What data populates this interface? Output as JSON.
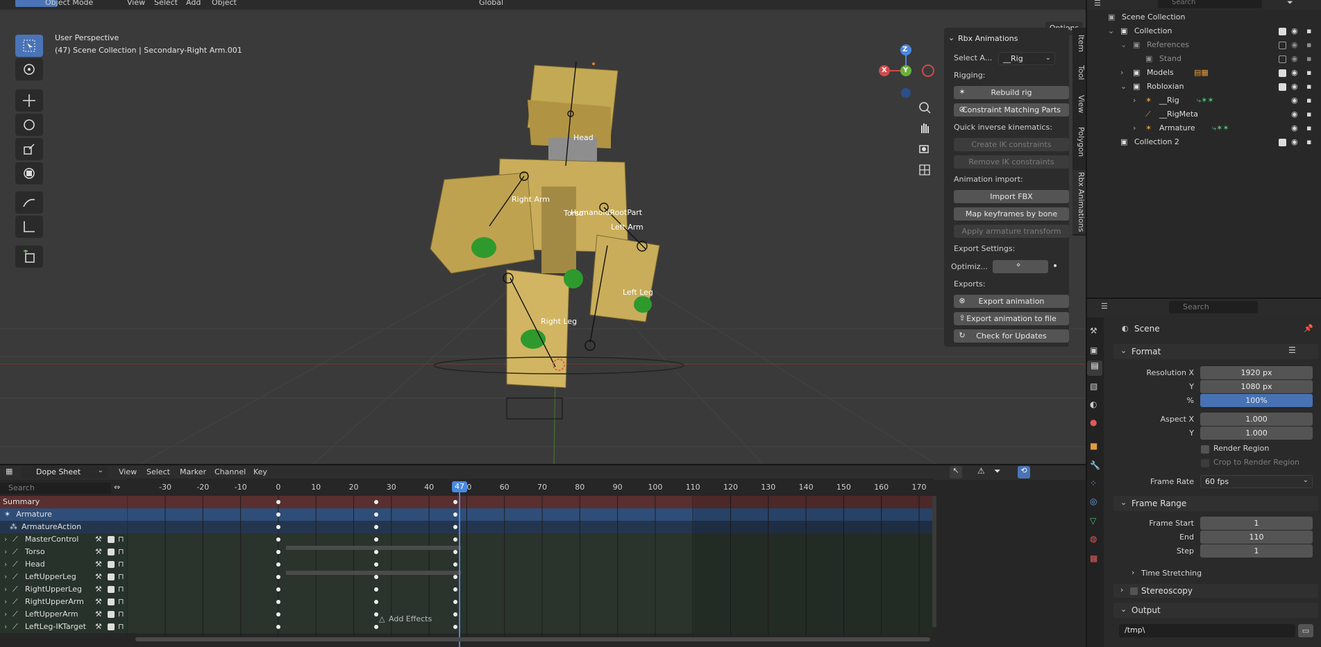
{
  "top_menu": {
    "mode": "Object Mode",
    "view": "View",
    "select": "Select",
    "add": "Add",
    "object": "Object",
    "orientation": "Global",
    "search_placeholder": "Search"
  },
  "viewport": {
    "title": "User Perspective",
    "subtitle": "(47) Scene Collection | Secondary-Right Arm.001",
    "options_label": "Options",
    "bone_labels": {
      "head": "Head",
      "right_arm": "Right Arm",
      "torso": "Torso",
      "root": "HumanoidRootPart",
      "left_arm": "Left Arm",
      "left_leg": "Left Leg",
      "right_leg": "Right Leg"
    },
    "gizmo": {
      "x": "X",
      "y": "Y",
      "z": "Z"
    }
  },
  "npanel": {
    "title": "Rbx Animations",
    "select_label": "Select A...",
    "select_value": "__Rig",
    "rigging_label": "Rigging:",
    "rebuild_rig": "Rebuild rig",
    "constraint_matching": "Constraint Matching Parts",
    "quick_ik_label": "Quick inverse kinematics:",
    "create_ik": "Create IK constraints",
    "remove_ik": "Remove IK constraints",
    "animation_import_label": "Animation import:",
    "import_fbx": "Import FBX",
    "map_keyframes": "Map keyframes by bone name",
    "apply_armature": "Apply armature transform",
    "export_settings_label": "Export Settings:",
    "optimize_label": "Optimiz...",
    "exports_label": "Exports:",
    "export_animation": "Export animation",
    "export_to_file": "Export animation to file",
    "check_updates": "Check for Updates",
    "tabs": [
      "Item",
      "Tool",
      "View",
      "Polygon",
      "Rbx Animations"
    ]
  },
  "dopesheet": {
    "mode": "Dope Sheet",
    "menu": [
      "View",
      "Select",
      "Marker",
      "Channel",
      "Key"
    ],
    "search_placeholder": "Search",
    "current_frame": "47",
    "ticks": [
      "-30",
      "-20",
      "-10",
      "0",
      "10",
      "20",
      "30",
      "40",
      "50",
      "60",
      "70",
      "80",
      "90",
      "100",
      "110",
      "120",
      "130",
      "140",
      "150",
      "160",
      "170"
    ],
    "channels": {
      "summary": "Summary",
      "armature": "Armature",
      "action": "ArmatureAction",
      "bones": [
        "MasterControl",
        "Torso",
        "Head",
        "LeftUpperLeg",
        "RightUpperLeg",
        "RightUpperArm",
        "LeftUpperArm",
        "LeftLeg-IKTarget"
      ]
    },
    "add_effects": "Add Effects"
  },
  "outliner": {
    "search_placeholder": "Search",
    "scene_collection": "Scene Collection",
    "collection": "Collection",
    "references": "References",
    "stand": "Stand",
    "models": "Models",
    "robloxian": "Robloxian",
    "rig": "__Rig",
    "rigmeta": "__RigMeta",
    "armature": "Armature",
    "collection2": "Collection 2"
  },
  "properties": {
    "search_placeholder": "Search",
    "scene": "Scene",
    "format": "Format",
    "resolution_x_label": "Resolution X",
    "resolution_x": "1920 px",
    "y_label": "Y",
    "resolution_y": "1080 px",
    "percent_label": "%",
    "percent": "100%",
    "aspect_x_label": "Aspect X",
    "aspect_x": "1.000",
    "aspect_y": "1.000",
    "render_region": "Render Region",
    "crop_region": "Crop to Render Region",
    "frame_rate_label": "Frame Rate",
    "frame_rate": "60 fps",
    "frame_range": "Frame Range",
    "frame_start_label": "Frame Start",
    "frame_start": "1",
    "end_label": "End",
    "end": "110",
    "step_label": "Step",
    "step": "1",
    "time_stretching": "Time Stretching",
    "stereoscopy": "Stereoscopy",
    "output": "Output",
    "output_path": "/tmp\\"
  },
  "colors": {
    "accent": "#4772b3",
    "keyframe": "#f0f0f0",
    "playhead": "#4a88e0",
    "model": "#c9ad5a"
  }
}
